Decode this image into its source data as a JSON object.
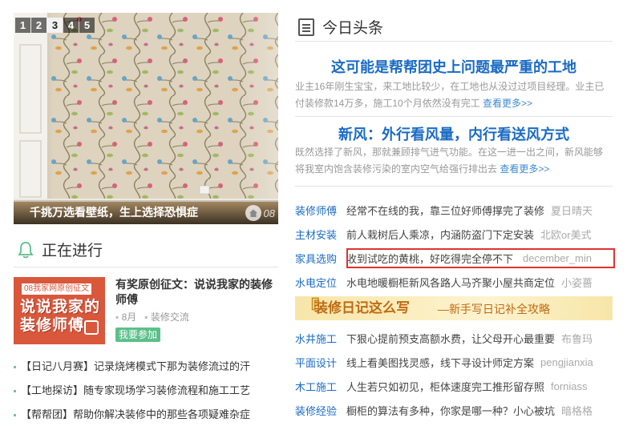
{
  "slideshow": {
    "numbers": [
      "1",
      "2",
      "3",
      "4",
      "5"
    ],
    "active_index": 2,
    "caption": "千挑万选看壁纸，生上选择恐惧症",
    "watermark": "08"
  },
  "in_progress": {
    "title": "正在进行",
    "promo": {
      "image_tag": "08我家网原创征文",
      "image_text_line1": "说说我家的",
      "image_text_line2": "装修师傅",
      "title": "有奖原创征文：说说我家的装修师傅",
      "month": "8月",
      "category": "装修交流",
      "button": "我要参加"
    },
    "list": [
      "【日记八月赛】记录烧烤模式下那为装修流过的汗",
      "【工地探访】随专家现场学习装修流程和施工工艺",
      "【帮帮团】帮助你解决装修中的那些各项疑难杂症"
    ]
  },
  "headlines": {
    "title": "今日头条",
    "news": [
      {
        "title": "这可能是帮帮团史上问题最严重的工地",
        "body": "业主16年刚生宝宝，来工地比较少，在工地也从没过过项目经理。业主已付装修款14万多，施工10个月依然没有完工",
        "more": "查看更多>>"
      },
      {
        "title": "新风：外行看风量，内行看送风方式",
        "body": "既然选择了新风，那就兼顾排气进气功能。在这一进一出之间，新风能够将我室内饱含装修污染的室内空气给强行排出去",
        "more": "查看更多>>"
      }
    ],
    "list_a": [
      {
        "cat": "装修师傅",
        "text": "经常不在线的我，靠三位好师傅撑完了装修",
        "user": "夏日晴天"
      },
      {
        "cat": "主材安装",
        "text": "前人栽树后人乘凉，内涵防盗门下定安装",
        "user": "北欧or美式"
      },
      {
        "cat": "家具选购",
        "text": "收到试吃的黄桃，好吃得完全停不下",
        "user": "december_min"
      },
      {
        "cat": "水电定位",
        "text": "水电地暖橱柜新风各路人马齐聚小屋共商定位",
        "user": "小姿薔"
      }
    ],
    "banner": {
      "mark": "『",
      "title": "装修日记这么写",
      "subtitle": "—新手写日记补全攻略"
    },
    "list_b": [
      {
        "cat": "水井施工",
        "text": "下狠心提前预支高额水费，让父母开心最重要",
        "user": "布鲁玛"
      },
      {
        "cat": "平面设计",
        "text": "线上看美图找灵感，线下寻设计师定方案",
        "user": "pengjianxia"
      },
      {
        "cat": "木工施工",
        "text": "人生若只如初见，柜体速度完工推形留存照",
        "user": "forniass"
      },
      {
        "cat": "装修经验",
        "text": "橱柜的算法有多种，你家是哪一种？小心被坑",
        "user": "暗格格"
      }
    ]
  },
  "colors": {
    "link_blue": "#1a6bc4",
    "highlight_red": "#e0332f",
    "green_button": "#5cbf8a",
    "promo_red": "#d9573b"
  }
}
